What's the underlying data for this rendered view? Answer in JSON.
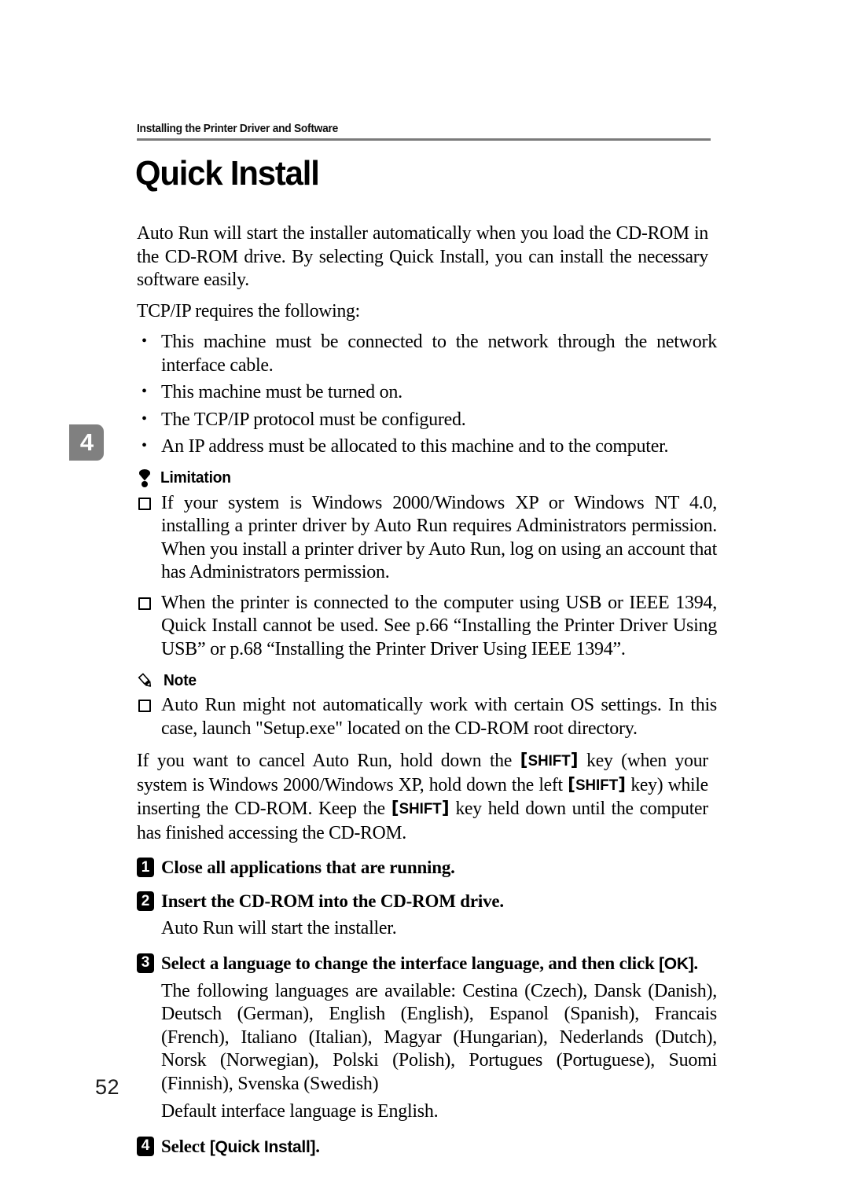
{
  "document": {
    "running_header": "Installing the Printer Driver and Software",
    "chapter_tab": "4",
    "title": "Quick Install",
    "page_number": "52"
  },
  "intro": {
    "paragraph_1": "Auto Run will start the installer automatically when you load the CD-ROM in the CD-ROM drive. By selecting Quick Install, you can install the necessary software easily.",
    "paragraph_2": "TCP/IP requires the following:"
  },
  "requirements": [
    "This machine must be connected to the network through the network interface cable.",
    "This machine must be turned on.",
    "The TCP/IP protocol must be configured.",
    "An IP address must be allocated to this machine and to the computer."
  ],
  "limitation": {
    "icon": "exclamation-drop-icon",
    "label": "Limitation",
    "items": [
      "If your system is Windows 2000/Windows XP or Windows NT 4.0, installing a printer driver by Auto Run requires Administrators permission. When you install a printer driver by Auto Run, log on using an account that has Administrators permission.",
      "When the printer is connected to the computer using USB or IEEE 1394, Quick Install cannot be used. See p.66 “Installing the Printer Driver Using USB” or p.68 “Installing the Printer Driver Using IEEE 1394”."
    ]
  },
  "note": {
    "icon": "pencil-icon",
    "label": "Note",
    "items": [
      "Auto Run might not automatically work with certain OS settings. In this case, launch \"Setup.exe\" located on the CD-ROM root directory."
    ]
  },
  "cancel_paragraph": {
    "part_1": "If you want to cancel Auto Run, hold down the ",
    "key_1": "SHIFT",
    "part_2": " key (when your system is Windows 2000/Windows XP, hold down the left ",
    "key_2": "SHIFT",
    "part_3": " key) while inserting the CD-ROM. Keep the ",
    "key_3": "SHIFT",
    "part_4": " key held down until the computer has finished accessing the CD-ROM."
  },
  "steps": [
    {
      "number": "1",
      "heading": "Close all applications that are running.",
      "sub": []
    },
    {
      "number": "2",
      "heading": "Insert the CD-ROM into the CD-ROM drive.",
      "sub": [
        "Auto Run will start the installer."
      ]
    },
    {
      "number": "3",
      "heading_before": "Select a language to change the interface language, and then click ",
      "heading_token": "[OK]",
      "heading_after": ".",
      "sub": [
        "The following languages are available: Cestina (Czech), Dansk (Danish), Deutsch (German), English (English), Espanol (Spanish), Francais (French), Italiano (Italian), Magyar (Hungarian), Nederlands (Dutch), Norsk (Norwegian), Polski (Polish), Portugues (Portuguese), Suomi (Finnish), Svenska (Swedish)",
        "Default interface language is English."
      ]
    },
    {
      "number": "4",
      "heading_before": "Select ",
      "heading_token": "[Quick Install]",
      "heading_after": ".",
      "sub": []
    }
  ]
}
